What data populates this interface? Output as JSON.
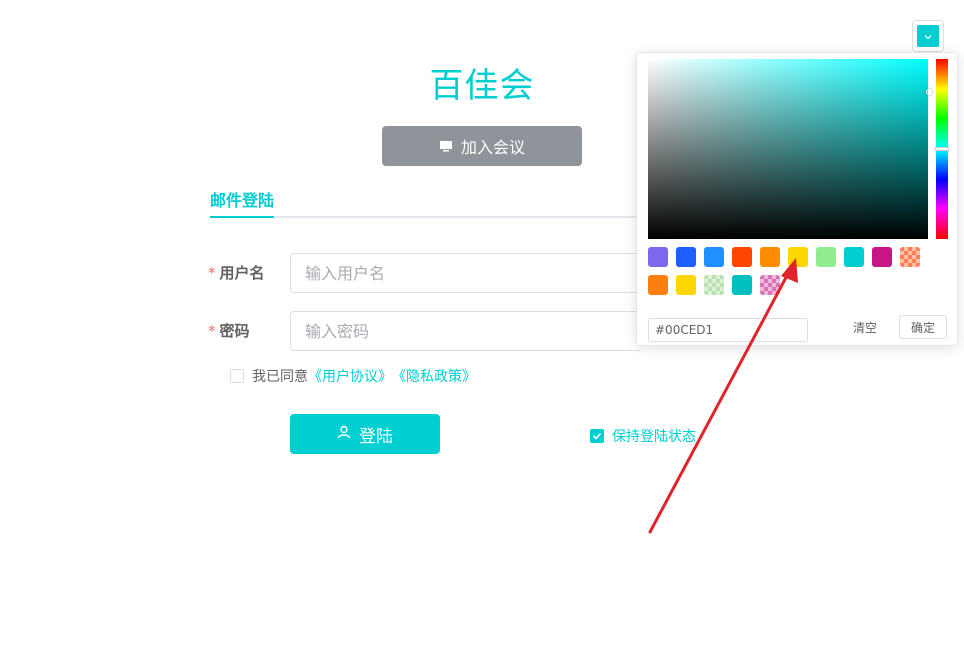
{
  "app": {
    "title": "百佳会"
  },
  "join": {
    "label": "加入会议",
    "icon": "monitor-icon"
  },
  "tabs": [
    {
      "label": "邮件登陆",
      "active": true
    }
  ],
  "form": {
    "username": {
      "label": "用户名",
      "required_mark": "*",
      "placeholder": "输入用户名"
    },
    "password": {
      "label": "密码",
      "required_mark": "*",
      "placeholder": "输入密码"
    },
    "agreement": {
      "prefix": "我已同意",
      "user_agreement": "《用户协议》",
      "privacy_policy": "《隐私政策》",
      "checked": false
    },
    "login": {
      "label": "登陆",
      "icon": "user-icon"
    },
    "keep_login": {
      "label": "保持登陆状态",
      "checked": true
    }
  },
  "color_picker": {
    "current_color": "#00CED1",
    "hue_color": "#00FFFF",
    "hex_value": "#00CED1",
    "clear_label": "清空",
    "confirm_label": "确定",
    "predefine": [
      "#7B68EE",
      "#1E5EFF",
      "#1E90FF",
      "#FF4500",
      "#FF8C00",
      "#FFD700",
      "#90EE90",
      "#00CED1",
      "#C71585",
      "#FF7F50",
      "#FF7F0E",
      "#FFD700",
      "#B8E0B0",
      "#00BFBF",
      "#D973B8"
    ]
  },
  "annotation": {
    "color": "#E0242B"
  }
}
